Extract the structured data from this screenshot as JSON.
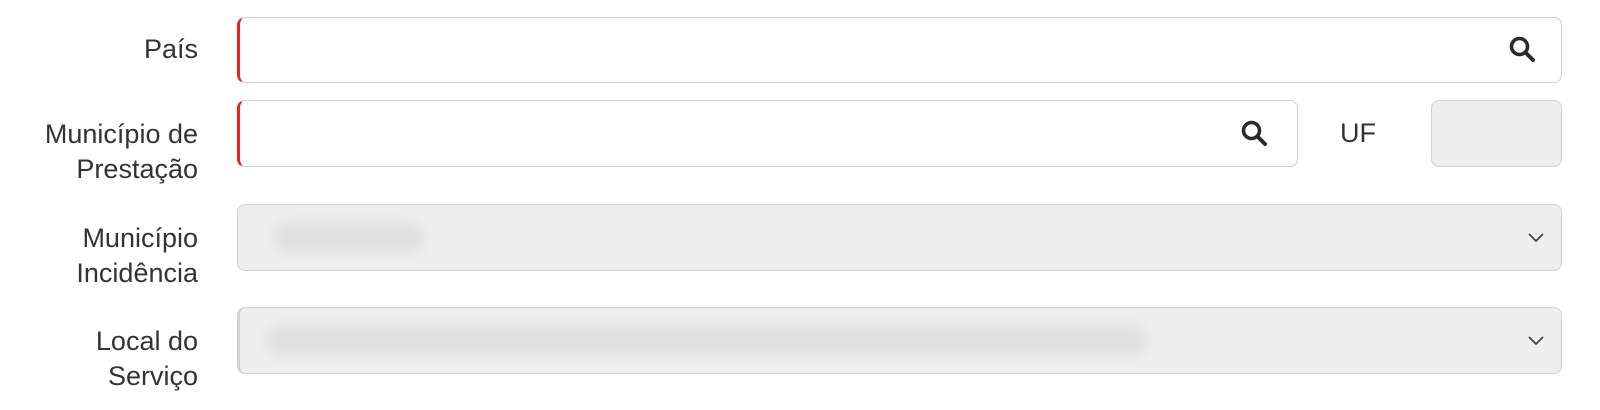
{
  "form": {
    "pais": {
      "label": "País",
      "value": ""
    },
    "municipio_prestacao": {
      "label_line1": "Município de",
      "label_line2": "Prestação",
      "value": ""
    },
    "uf": {
      "label": "UF",
      "value": ""
    },
    "municipio_incidencia": {
      "label_line1": "Município",
      "label_line2": "Incidência",
      "selected": ""
    },
    "local_servico": {
      "label_line1": "Local do",
      "label_line2": "Serviço",
      "selected": ""
    }
  },
  "icons": {
    "search": "search-icon",
    "dropdown": "chevron-down-icon"
  },
  "colors": {
    "required_marker": "#e8231c",
    "disabled_bg": "#eeeeee",
    "border": "#cfcfcf",
    "text": "#333333"
  }
}
